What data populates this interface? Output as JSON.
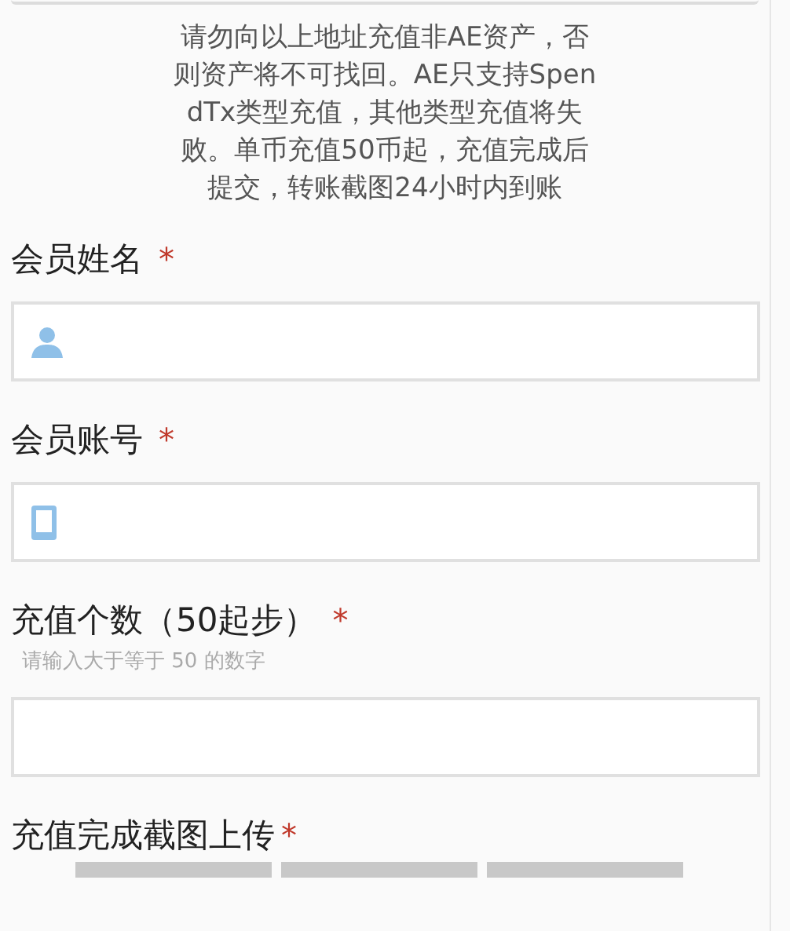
{
  "notice": "请勿向以上地址充值非AE资产，否则资产将不可找回。AE只支持SpendTx类型充值，其他类型充值将失败。单币充值50币起，充值完成后提交，转账截图24小时内到账",
  "fields": [
    {
      "label": "会员姓名",
      "required_mark": "*",
      "kind": "person"
    },
    {
      "label": "会员账号",
      "required_mark": "*",
      "kind": "tablet"
    },
    {
      "label": "充值个数（50起步）",
      "required_mark": "*",
      "hint": "请输入大于等于 50 的数字",
      "kind": "plain"
    }
  ],
  "upload": {
    "label": "充值完成截图上传",
    "required_mark": "*",
    "slots": [
      {
        "kind": "thumbnail"
      },
      {
        "kind": "thumbnail"
      },
      {
        "kind": "thumbnail"
      }
    ]
  }
}
